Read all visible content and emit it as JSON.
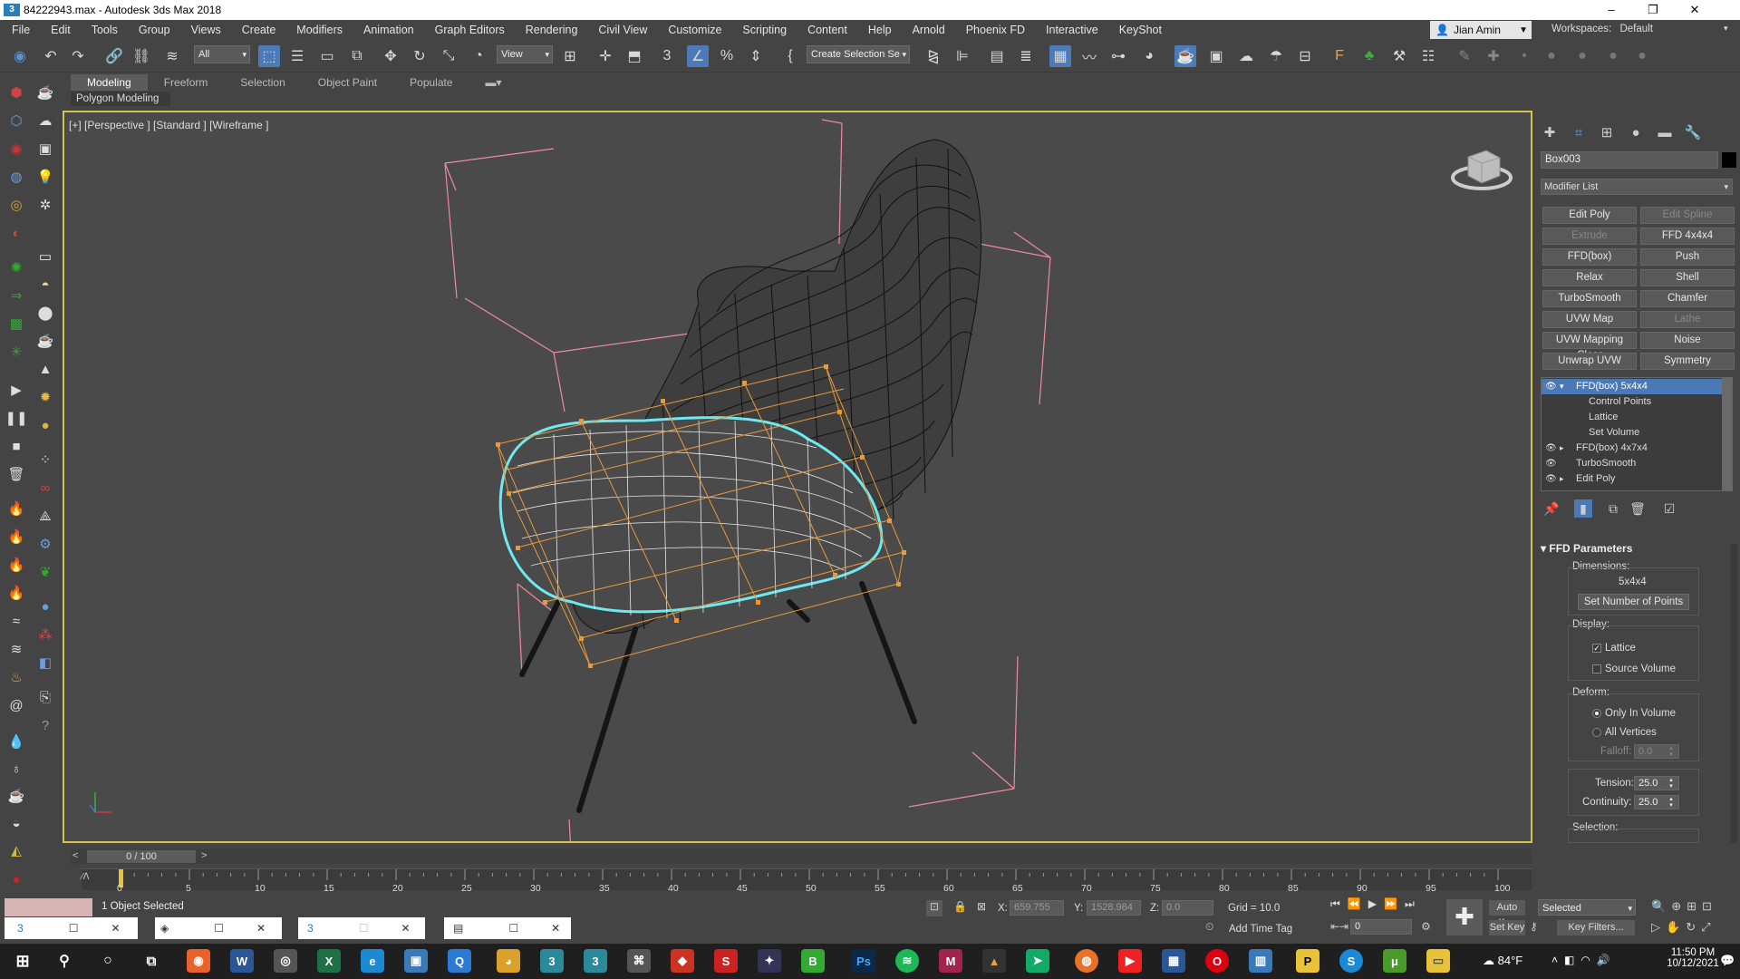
{
  "titlebar": {
    "title": "84222943.max - Autodesk 3ds Max 2018"
  },
  "menu": [
    "File",
    "Edit",
    "Tools",
    "Group",
    "Views",
    "Create",
    "Modifiers",
    "Animation",
    "Graph Editors",
    "Rendering",
    "Civil View",
    "Customize",
    "Scripting",
    "Content",
    "Help",
    "Arnold",
    "Phoenix FD",
    "Interactive",
    "KeyShot"
  ],
  "user": {
    "name": "Jian Amin",
    "workspaces_label": "Workspaces:",
    "workspace": "Default"
  },
  "toolbar": {
    "filter": "All",
    "refcoord": "View",
    "selection_set": "Create Selection Se"
  },
  "ribbon": {
    "tabs": [
      "Modeling",
      "Freeform",
      "Selection",
      "Object Paint",
      "Populate"
    ],
    "sub_label": "Polygon Modeling"
  },
  "viewport": {
    "label": "[+] [Perspective ] [Standard ] [Wireframe ]"
  },
  "command_panel": {
    "object_name": "Box003",
    "modifier_list": "Modifier List",
    "modifier_buttons": [
      {
        "label": "Edit Poly",
        "enabled": true
      },
      {
        "label": "Edit Spline",
        "enabled": false
      },
      {
        "label": "Extrude",
        "enabled": false
      },
      {
        "label": "FFD 4x4x4",
        "enabled": true
      },
      {
        "label": "FFD(box)",
        "enabled": true
      },
      {
        "label": "Push",
        "enabled": true
      },
      {
        "label": "Relax",
        "enabled": true
      },
      {
        "label": "Shell",
        "enabled": true
      },
      {
        "label": "TurboSmooth",
        "enabled": true
      },
      {
        "label": "Chamfer",
        "enabled": true
      },
      {
        "label": "UVW Map",
        "enabled": true
      },
      {
        "label": "Lathe",
        "enabled": false
      },
      {
        "label": "UVW Mapping Clear",
        "enabled": true
      },
      {
        "label": "Noise",
        "enabled": true
      },
      {
        "label": "Unwrap UVW",
        "enabled": true
      },
      {
        "label": "Symmetry",
        "enabled": true
      }
    ],
    "stack": [
      {
        "label": "FFD(box) 5x4x4",
        "selected": true
      },
      {
        "label": "Control Points"
      },
      {
        "label": "Lattice"
      },
      {
        "label": "Set Volume"
      },
      {
        "label": "FFD(box) 4x7x4"
      },
      {
        "label": "TurboSmooth"
      },
      {
        "label": "Edit Poly"
      }
    ],
    "ffd": {
      "header": "FFD Parameters",
      "dimensions_label": "Dimensions:",
      "dimensions": "5x4x4",
      "set_points": "Set Number of Points",
      "display_label": "Display:",
      "lattice": "Lattice",
      "source_volume": "Source Volume",
      "deform_label": "Deform:",
      "only_in_volume": "Only In Volume",
      "all_vertices": "All Vertices",
      "falloff_label": "Falloff:",
      "falloff": "0.0",
      "tension_label": "Tension:",
      "tension": "25.0",
      "continuity_label": "Continuity:",
      "continuity": "25.0",
      "selection_label": "Selection:"
    }
  },
  "timeline": {
    "slider": "0 / 100",
    "ticks": [
      "0",
      "5",
      "10",
      "15",
      "20",
      "25",
      "30",
      "35",
      "40",
      "45",
      "50",
      "55",
      "60",
      "65",
      "70",
      "75",
      "80",
      "85",
      "90",
      "95",
      "100"
    ]
  },
  "status": {
    "message": "1 Object Selected",
    "x_label": "X:",
    "x": "659.755",
    "y_label": "Y:",
    "y": "1528.984",
    "z_label": "Z:",
    "z": "0.0",
    "grid": "Grid = 10.0",
    "add_time_tag": "Add Time Tag",
    "auto_key": "Auto Key",
    "set_key": "Set Key",
    "key_mode": "Selected",
    "key_filters": "Key Filters...",
    "frame": "0"
  },
  "taskbar": {
    "weather": "84°F",
    "time": "11:50 PM",
    "date": "10/12/2021"
  },
  "colors": {
    "accent": "#4b79b6",
    "viewport_border": "#d9c24b",
    "selection_cyan": "#6fe8f0",
    "lattice_orange": "#e89a3a",
    "bbox_pink": "#f08aa0"
  }
}
